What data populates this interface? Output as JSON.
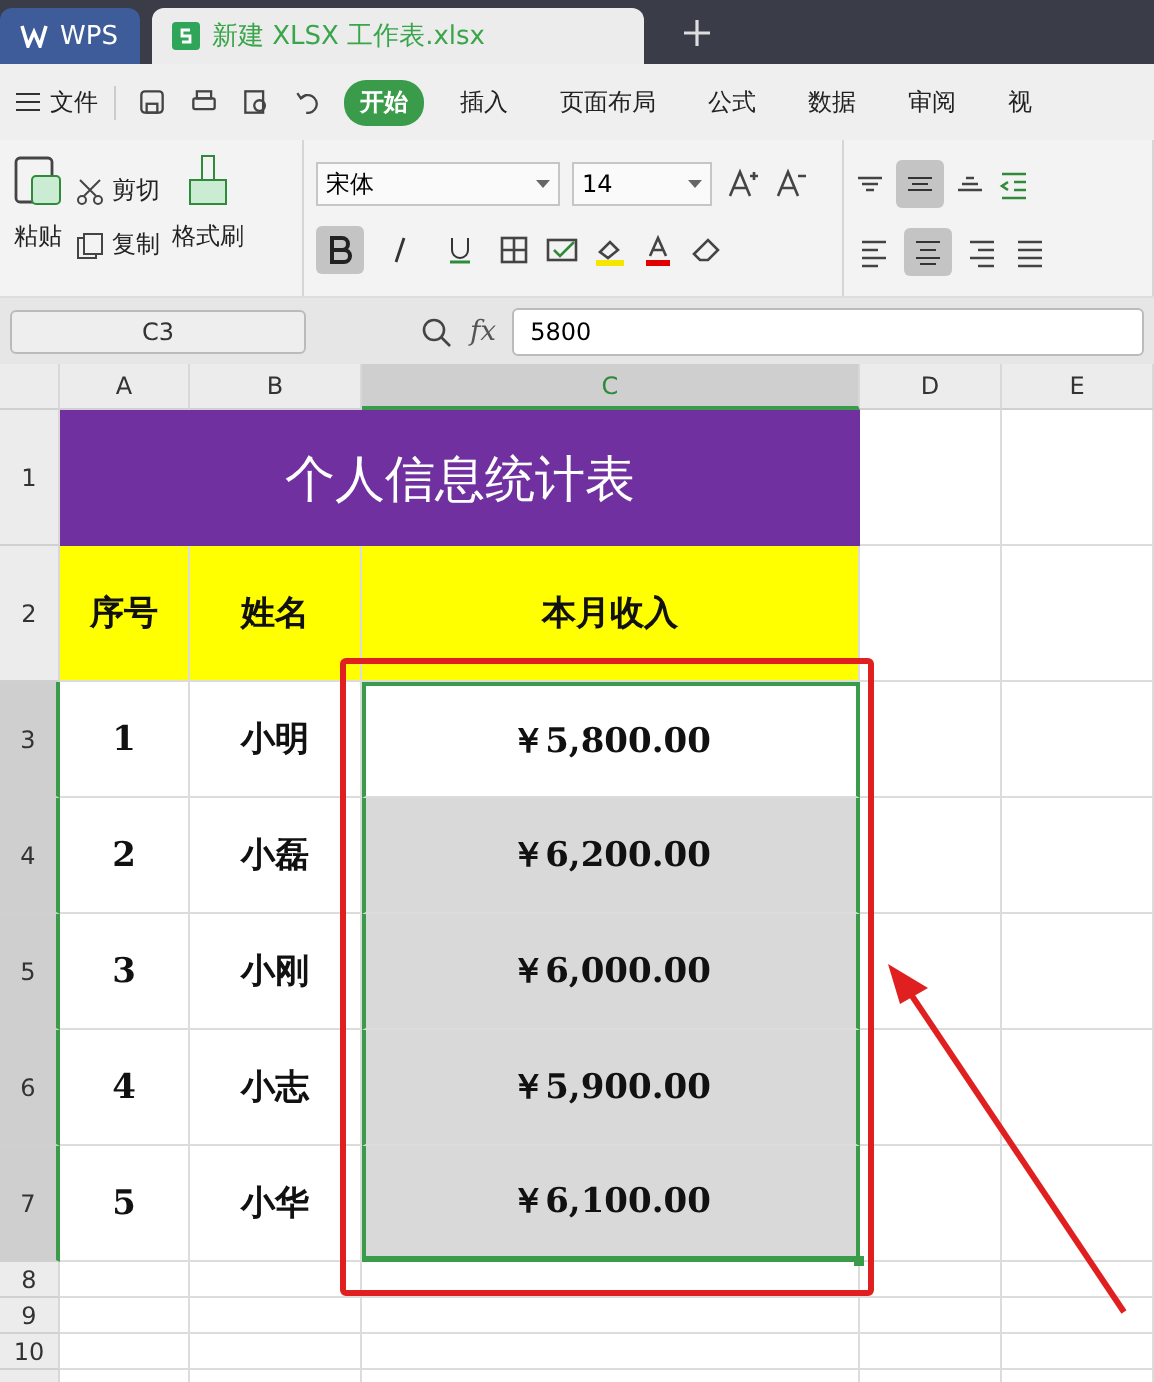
{
  "tabs": [
    {
      "label": "WPS",
      "kind": "home",
      "selected": false
    },
    {
      "label": "新建 XLSX 工作表.xlsx",
      "kind": "doc",
      "selected": true
    }
  ],
  "menu": {
    "file": "文件",
    "items": [
      {
        "label": "开始",
        "selected": true
      },
      {
        "label": "插入",
        "selected": false
      },
      {
        "label": "页面布局",
        "selected": false
      },
      {
        "label": "公式",
        "selected": false
      },
      {
        "label": "数据",
        "selected": false
      },
      {
        "label": "审阅",
        "selected": false
      },
      {
        "label": "视",
        "selected": false
      }
    ]
  },
  "ribbon": {
    "paste": "粘贴",
    "cut": "剪切",
    "copy": "复制",
    "painter": "格式刷",
    "font": "宋体",
    "size": "14",
    "bold": true,
    "italic": false,
    "underline": false,
    "align_center": true,
    "valign_middle": true
  },
  "formula_bar": {
    "name_box": "C3",
    "fx": "fx",
    "value": "5800"
  },
  "sheet": {
    "columns": [
      {
        "label": "A",
        "selected": false
      },
      {
        "label": "B",
        "selected": false
      },
      {
        "label": "C",
        "selected": true
      },
      {
        "label": "D",
        "selected": false
      },
      {
        "label": "E",
        "selected": false
      }
    ],
    "title": "个人信息统计表",
    "headers": [
      "序号",
      "姓名",
      "本月收入"
    ],
    "rows": [
      {
        "row": "3",
        "num": "1",
        "name": "小明",
        "income": "￥5,800.00",
        "selected": true,
        "active": true
      },
      {
        "row": "4",
        "num": "2",
        "name": "小磊",
        "income": "￥6,200.00",
        "selected": true,
        "active": false
      },
      {
        "row": "5",
        "num": "3",
        "name": "小刚",
        "income": "￥6,000.00",
        "selected": true,
        "active": false
      },
      {
        "row": "6",
        "num": "4",
        "name": "小志",
        "income": "￥5,900.00",
        "selected": true,
        "active": false
      },
      {
        "row": "7",
        "num": "5",
        "name": "小华",
        "income": "￥6,100.00",
        "selected": true,
        "active": false
      }
    ],
    "header_rows": [
      "1",
      "2"
    ],
    "empty_rows": [
      "8",
      "9",
      "10"
    ]
  }
}
